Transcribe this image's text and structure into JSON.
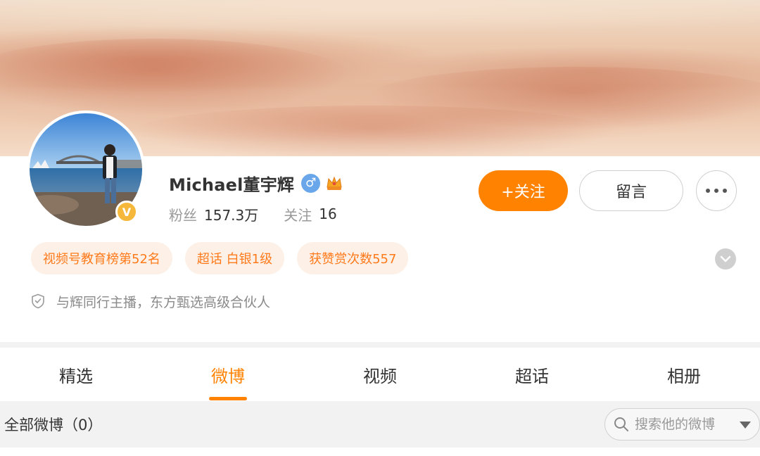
{
  "profile": {
    "name": "Michael董宇辉",
    "gender_icon": "male-icon",
    "badge_icon": "crown-icon",
    "verified_icon": "verified-v-icon",
    "verified_mark": "V",
    "stats": [
      {
        "label": "粉丝",
        "value": "157.3万"
      },
      {
        "label": "关注",
        "value": "16"
      }
    ],
    "bio": "与辉同行主播，东方甄选高级合伙人"
  },
  "actions": {
    "follow_label": "+关注",
    "message_label": "留言",
    "more_icon": "more-dots-icon"
  },
  "tags": [
    {
      "label": "视频号教育榜第52名"
    },
    {
      "label": "超话 白银1级"
    },
    {
      "label": "获赞赏次数557"
    }
  ],
  "tabs": [
    {
      "label": "精选",
      "active": false
    },
    {
      "label": "微博",
      "active": true
    },
    {
      "label": "视频",
      "active": false
    },
    {
      "label": "超话",
      "active": false
    },
    {
      "label": "相册",
      "active": false
    }
  ],
  "filter": {
    "label": "全部微博（0）",
    "search_placeholder": "搜索他的微博"
  },
  "colors": {
    "accent": "#ff8200",
    "tag_bg": "#fdf0e7",
    "tag_text": "#ff7a1a",
    "gender": "#6aa7ea",
    "verified": "#f5b83b"
  }
}
